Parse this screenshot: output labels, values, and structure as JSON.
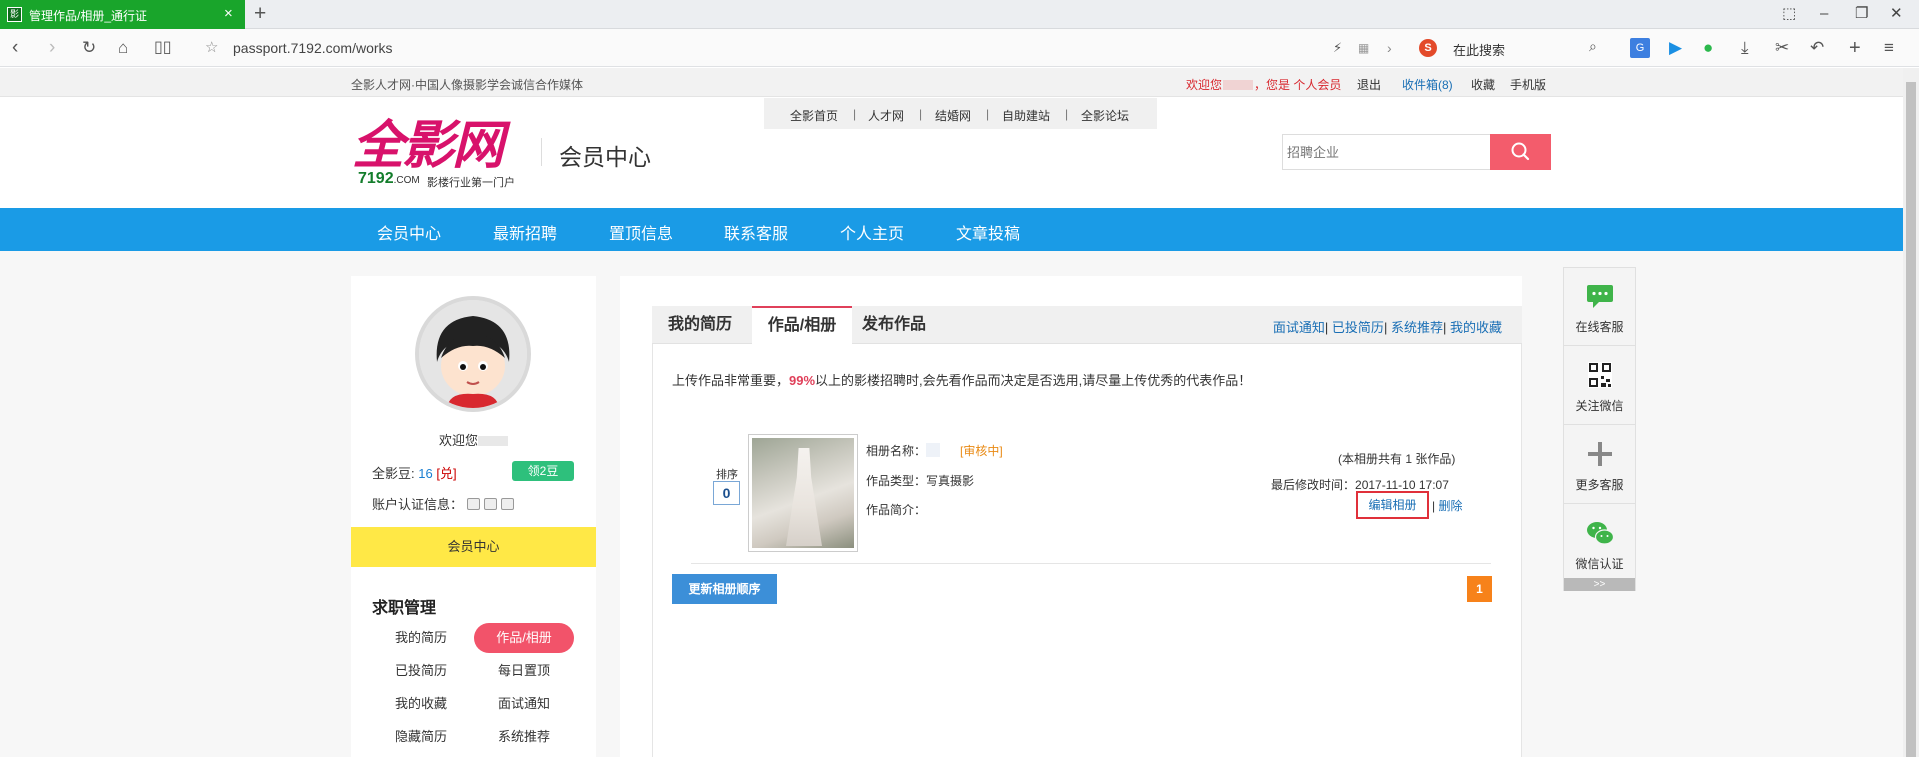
{
  "browser": {
    "tab_title": "管理作品/相册_通行证",
    "url": "passport.7192.com/works",
    "search_placeholder": "在此搜索",
    "new_tab": "+",
    "close": "×"
  },
  "topbar": {
    "slogan": "全影人才网·中国人像摄影学会诚信合作媒体",
    "welcome": "欢迎您",
    "welcome_role": "，您是 个人会员",
    "logout": "退出",
    "inbox": "收件箱(8)",
    "favorites": "收藏",
    "mobile": "手机版"
  },
  "subnav": [
    "全影首页",
    "人才网",
    "结婚网",
    "自助建站",
    "全影论坛"
  ],
  "logo": {
    "name": "全影网",
    "domain": "7192",
    "domain_suffix": ".COM",
    "tagline": "影楼行业第一门户"
  },
  "header": {
    "title": "会员中心",
    "search_placeholder": "招聘企业"
  },
  "mainnav": [
    "会员中心",
    "最新招聘",
    "置顶信息",
    "联系客服",
    "个人主页",
    "文章投稿"
  ],
  "sidebar": {
    "welcome": "欢迎您",
    "beans_label": "全影豆: ",
    "beans_value": "16",
    "beans_redeem": "兑",
    "get_beans": "领2豆",
    "cert_label": "账户认证信息：",
    "yellow_bar": "会员中心",
    "section_title": "求职管理",
    "links": [
      [
        "我的简历",
        "作品/相册"
      ],
      [
        "已投简历",
        "每日置顶"
      ],
      [
        "我的收藏",
        "面试通知"
      ],
      [
        "隐藏简历",
        "系统推荐"
      ]
    ]
  },
  "content": {
    "tabs": [
      "我的简历",
      "作品/相册",
      "发布作品"
    ],
    "quick_links": [
      "面试通知",
      "已投简历",
      "系统推荐",
      "我的收藏"
    ],
    "notice_before": "上传作品非常重要，",
    "notice_highlight": "99%",
    "notice_after": "以上的影楼招聘时,会先看作品而决定是否选用,请尽量上传优秀的代表作品！",
    "album": {
      "sort_label": "排序",
      "sort_value": "0",
      "name_label": "相册名称：",
      "status": "[审核中]",
      "type_label": "作品类型：",
      "type_value": "写真摄影",
      "intro_label": "作品简介：",
      "count_text": "(本相册共有 1 张作品)",
      "modified_label": "最后修改时间：",
      "modified_value": "2017-11-10 17:07",
      "edit": "编辑相册",
      "delete": "删除"
    },
    "update_order": "更新相册顺序",
    "page_current": "1"
  },
  "float_panel": {
    "items": [
      "在线客服",
      "关注微信",
      "更多客服",
      "微信认证"
    ],
    "more": ">>"
  },
  "colors": {
    "nav_blue": "#1a9be6",
    "accent_pink": "#e0405a",
    "yellow": "#ffe846",
    "green": "#2ec07c",
    "orange": "#f7821a"
  }
}
